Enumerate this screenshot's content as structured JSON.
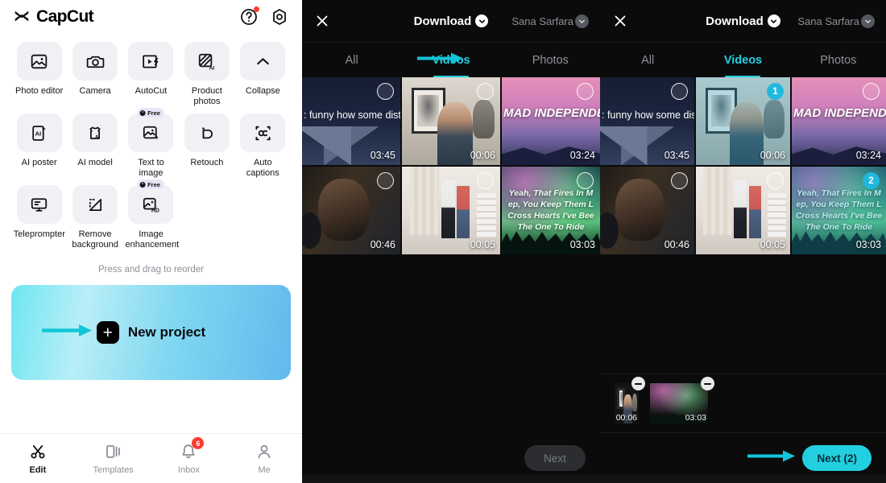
{
  "app": {
    "brand": "CapCut",
    "help_icon": "question-mark-circle-icon",
    "settings_icon": "gear-icon"
  },
  "home": {
    "tools": [
      {
        "label": "Photo editor",
        "icon": "photo-editor-icon",
        "badge": null
      },
      {
        "label": "Camera",
        "icon": "camera-icon",
        "badge": null
      },
      {
        "label": "AutoCut",
        "icon": "autocut-icon",
        "badge": null
      },
      {
        "label": "Product photos",
        "icon": "product-photos-ai-icon",
        "badge": null
      },
      {
        "label": "Collapse",
        "icon": "chevron-up-icon",
        "badge": null
      },
      {
        "label": "AI poster",
        "icon": "ai-poster-icon",
        "badge": null
      },
      {
        "label": "AI model",
        "icon": "ai-model-icon",
        "badge": null
      },
      {
        "label": "Text to image",
        "icon": "text-to-image-icon",
        "badge": "Free"
      },
      {
        "label": "Retouch",
        "icon": "retouch-icon",
        "badge": null
      },
      {
        "label": "Auto captions",
        "icon": "auto-captions-icon",
        "badge": null
      },
      {
        "label": "Teleprompter",
        "icon": "teleprompter-icon",
        "badge": null
      },
      {
        "label": "Remove background",
        "icon": "remove-background-icon",
        "badge": null
      },
      {
        "label": "Image enhancement",
        "icon": "image-enhancement-hd-icon",
        "badge": "Free"
      }
    ],
    "reorder_hint": "Press and drag to reorder",
    "new_project_label": "New project",
    "tabbar": [
      {
        "label": "Edit",
        "icon": "scissors-icon",
        "active": true,
        "badge": null
      },
      {
        "label": "Templates",
        "icon": "templates-icon",
        "active": false,
        "badge": null
      },
      {
        "label": "Inbox",
        "icon": "bell-icon",
        "active": false,
        "badge": "6"
      },
      {
        "label": "Me",
        "icon": "person-icon",
        "active": false,
        "badge": null
      }
    ]
  },
  "picker": {
    "title": "Download",
    "account": "Sana Sarfara",
    "close_icon": "close-icon",
    "title_chevron_icon": "chevron-down-icon",
    "account_chevron_icon": "chevron-down-icon",
    "tabs": [
      {
        "label": "All",
        "active": false
      },
      {
        "label": "Videos",
        "active": true
      },
      {
        "label": "Photos",
        "active": false
      }
    ],
    "media": [
      {
        "id": "m1",
        "duration": "03:45",
        "art": "night-quote",
        "caption": ": funny how some distan\nkes everything seem sm"
      },
      {
        "id": "m2",
        "duration": "00:06",
        "art": "girl-room",
        "caption": ""
      },
      {
        "id": "m3",
        "duration": "03:24",
        "art": "pink-sky",
        "caption": "MAD INDEPENDENT\n'T YOU EVER FORG"
      },
      {
        "id": "m4",
        "duration": "00:46",
        "art": "man-mic",
        "caption": ""
      },
      {
        "id": "m5",
        "duration": "00:05",
        "art": "couple-room",
        "caption": ""
      },
      {
        "id": "m6",
        "duration": "03:03",
        "art": "aurora",
        "caption": "Yeah, That Fires In M\nep, You Keep Them L\nCross Hearts I've Bee\nThe One To Ride"
      }
    ],
    "state_unselected": {
      "selections": [],
      "next_label": "Next",
      "next_enabled": false,
      "tray": []
    },
    "state_selected": {
      "selections": [
        {
          "media_id": "m2",
          "order": "1"
        },
        {
          "media_id": "m6",
          "order": "2"
        }
      ],
      "next_label": "Next (2)",
      "next_enabled": true,
      "tray": [
        {
          "duration": "00:06",
          "art": "girl-room",
          "remove_icon": "minus-circle-icon"
        },
        {
          "duration": "03:03",
          "art": "aurora",
          "remove_icon": "minus-circle-icon"
        }
      ]
    }
  },
  "annotations": {
    "arrow_color": "#11c5d8",
    "arrows": [
      {
        "target": "new-project-button"
      },
      {
        "target": "videos-tab"
      },
      {
        "target": "next-button"
      }
    ]
  },
  "colors": {
    "accent_cyan": "#22cfe0",
    "badge_red": "#ff3b30",
    "dark_bg": "#0b0b0c",
    "light_bg": "#ffffff"
  }
}
